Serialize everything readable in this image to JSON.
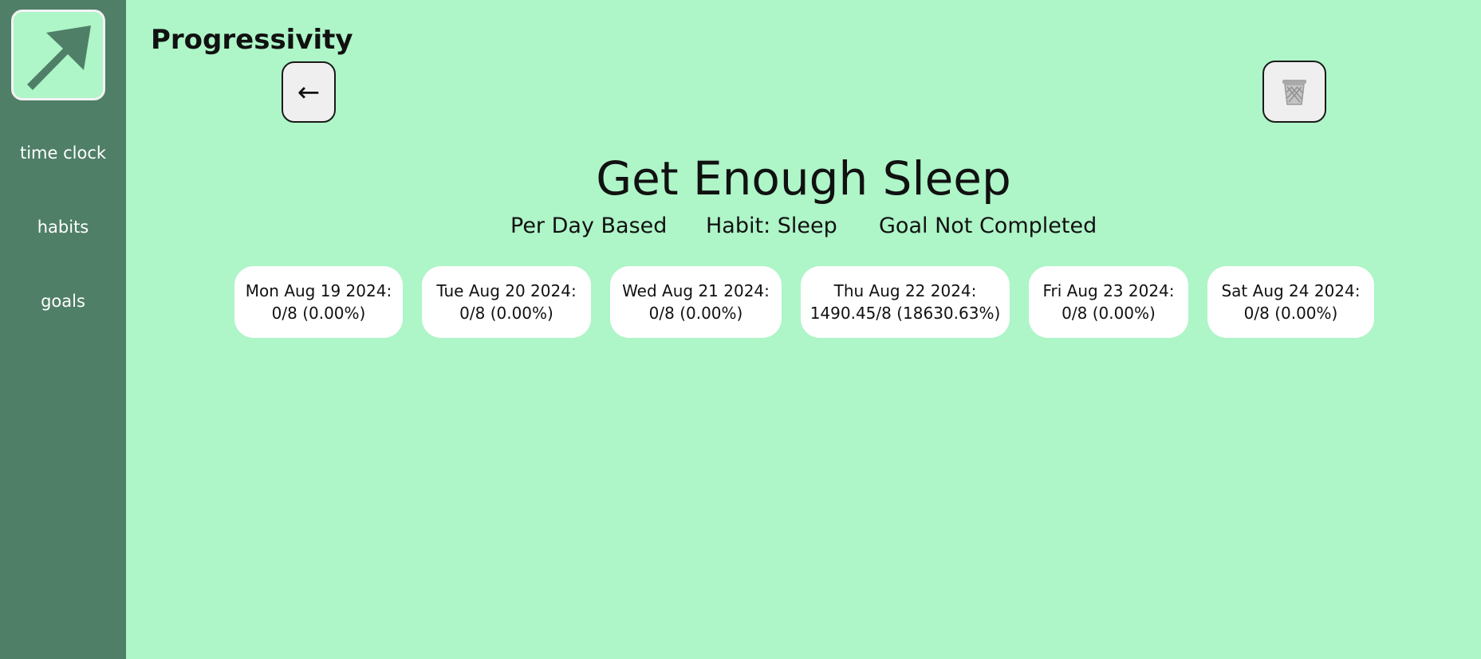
{
  "brand": "Progressivity",
  "sidebar": {
    "logo_icon": "arrow-up-right-icon",
    "items": [
      {
        "label": "time clock"
      },
      {
        "label": "habits"
      },
      {
        "label": "goals"
      }
    ]
  },
  "toolbar": {
    "back_label": "←",
    "delete_icon": "trash-icon"
  },
  "goal": {
    "title": "Get Enough Sleep",
    "basis": "Per Day Based",
    "habit": "Habit: Sleep",
    "status": "Goal Not Completed"
  },
  "days": [
    {
      "date": "Mon Aug 19 2024:",
      "progress": "0/8 (0.00%)"
    },
    {
      "date": "Tue Aug 20 2024:",
      "progress": "0/8 (0.00%)"
    },
    {
      "date": "Wed Aug 21 2024:",
      "progress": "0/8 (0.00%)"
    },
    {
      "date": "Thu Aug 22 2024:",
      "progress": "1490.45/8 (18630.63%)"
    },
    {
      "date": "Fri Aug 23 2024:",
      "progress": "0/8 (0.00%)"
    },
    {
      "date": "Sat Aug 24 2024:",
      "progress": "0/8 (0.00%)"
    }
  ],
  "colors": {
    "background": "#aef5c8",
    "sidebar": "#4f7f67",
    "card": "#ffffff"
  }
}
